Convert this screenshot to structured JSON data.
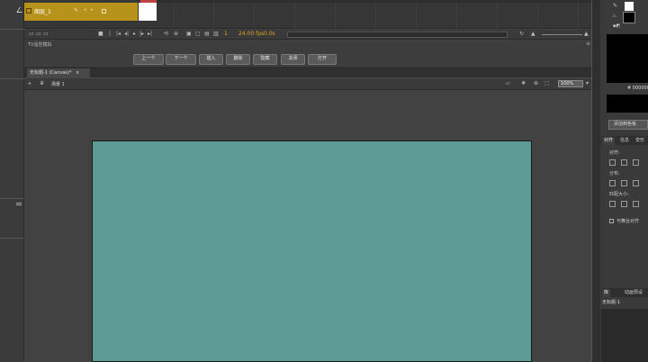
{
  "timeline": {
    "layer_name": "图层_1",
    "fps": "24.00 fps",
    "time": "0.0s"
  },
  "toolbar": {
    "title": "TV遥控模拟",
    "buttons": [
      "上一个",
      "下一个",
      "插入",
      "删除",
      "隐藏",
      "关闭",
      "打开"
    ]
  },
  "document": {
    "tab_title": "无标题-1 (Canvas)*",
    "tab_close": "×",
    "scene_label": "场景 1",
    "zoom": "100%"
  },
  "right_panel": {
    "hex_value": "# 000000",
    "button_label": "添加到色板",
    "tabs": [
      "对齐",
      "信息",
      "变形"
    ],
    "align_label": "对齐:",
    "distribute_label": "分布:",
    "match_size_label": "匹配大小:",
    "stage_checkbox": "与舞台对齐",
    "library_tabs": [
      "库",
      "动画预设"
    ],
    "library_item": "无标题-1"
  },
  "colors": {
    "stage": "#5e9a95",
    "layer_highlight": "#b8931c",
    "playhead": "#c04040"
  }
}
